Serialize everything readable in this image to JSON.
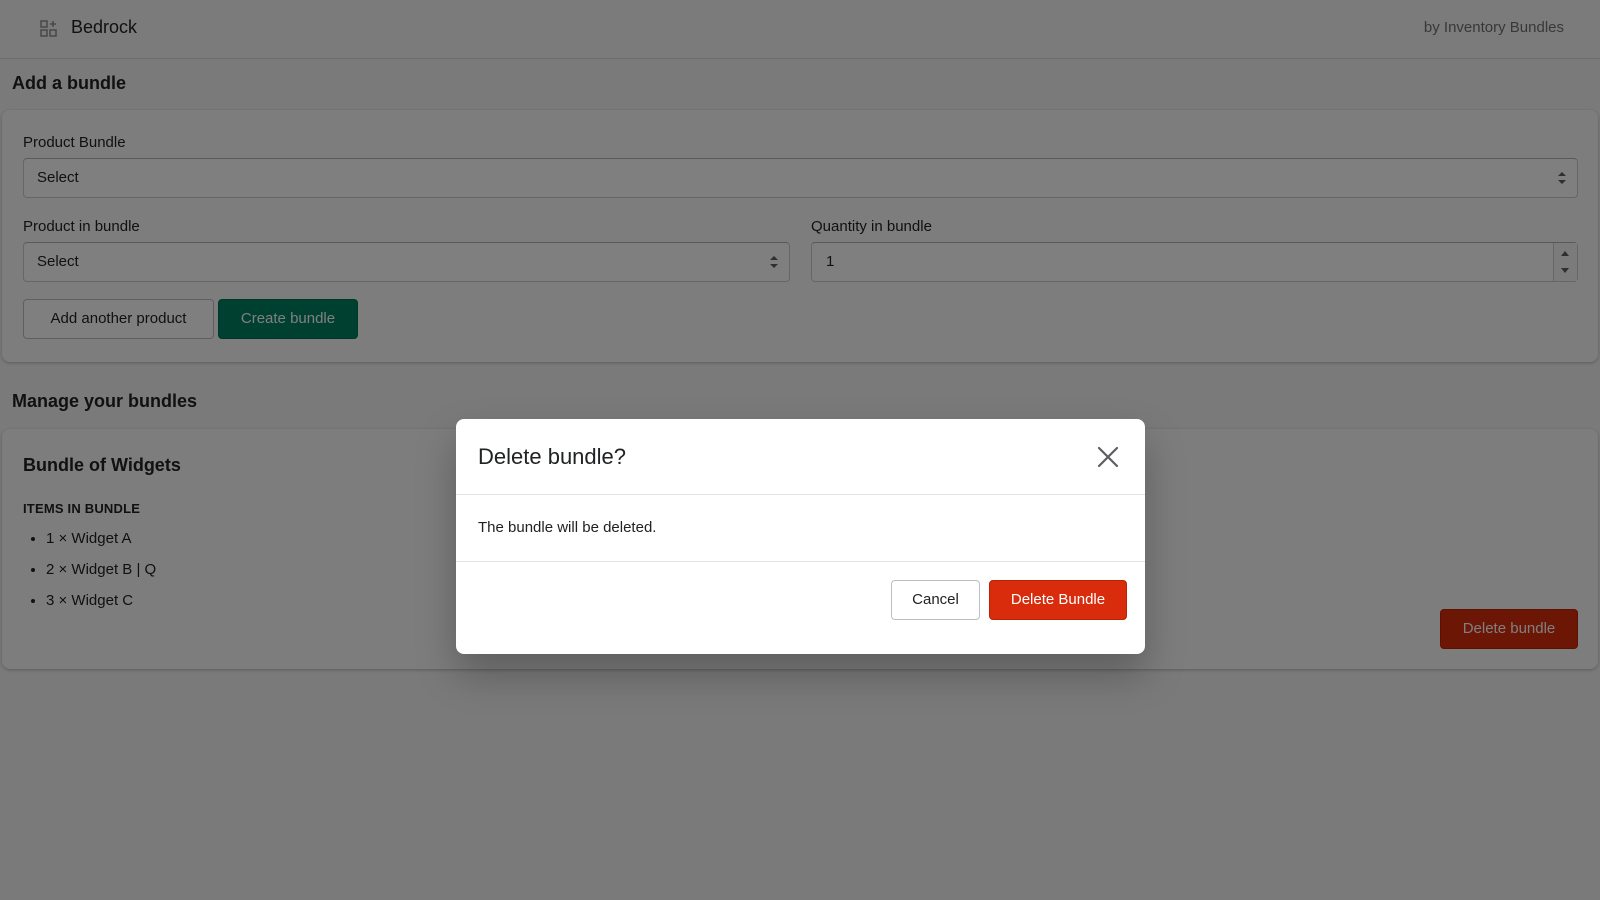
{
  "topbar": {
    "app_name": "Bedrock",
    "app_icon": "apps-grid-icon",
    "by_line": "by Inventory Bundles"
  },
  "add_bundle": {
    "section_title": "Add a bundle",
    "product_bundle_label": "Product Bundle",
    "product_bundle_value": "Select",
    "product_in_bundle_label": "Product in bundle",
    "product_in_bundle_value": "Select",
    "quantity_label": "Quantity in bundle",
    "quantity_value": "1",
    "add_another_label": "Add another product",
    "create_label": "Create bundle"
  },
  "manage": {
    "section_title": "Manage your bundles",
    "bundles": [
      {
        "title": "Bundle of Widgets",
        "items_heading": "ITEMS IN BUNDLE",
        "items": [
          "1 × Widget A",
          "2 × Widget B | Q",
          "3 × Widget C"
        ],
        "delete_label": "Delete bundle"
      }
    ]
  },
  "modal": {
    "title": "Delete bundle?",
    "body": "The bundle will be deleted.",
    "cancel_label": "Cancel",
    "confirm_label": "Delete Bundle",
    "close_icon": "close-icon"
  },
  "colors": {
    "primary": "#008060",
    "danger": "#d82c0d",
    "overlay": "rgba(0,0,0,0.5)"
  }
}
